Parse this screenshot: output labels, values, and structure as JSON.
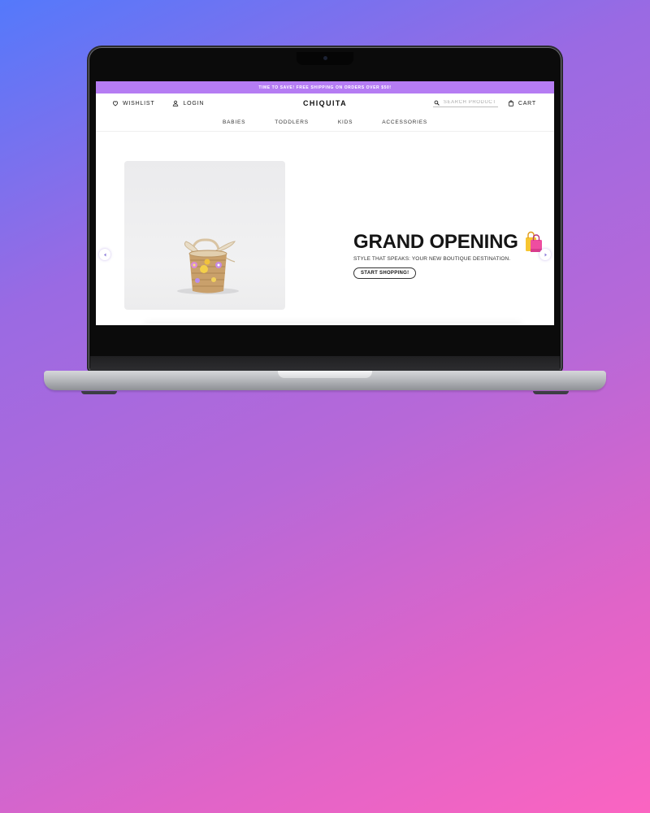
{
  "promo": {
    "text": "TIME TO SAVE! FREE SHIPPING ON ORDERS OVER $50!"
  },
  "header": {
    "wishlist_label": "WISHLIST",
    "login_label": "LOGIN",
    "brand": "CHIQUITA",
    "search_placeholder": "SEARCH PRODUCTS...",
    "cart_label": "CART"
  },
  "nav": {
    "items": [
      {
        "label": "BABIES"
      },
      {
        "label": "TODDLERS"
      },
      {
        "label": "KIDS"
      },
      {
        "label": "ACCESSORIES"
      }
    ]
  },
  "hero": {
    "title": "GRAND OPENING",
    "subtitle": "STYLE THAT SPEAKS: YOUR NEW BOUTIQUE DESTINATION.",
    "cta_label": "START SHOPPING!",
    "title_icon": "shopping-bags-icon"
  },
  "colors": {
    "promo_bar": "#b57cf3",
    "background_gradient_start": "#5479fb",
    "background_gradient_end": "#fb64c1",
    "text_primary": "#151515"
  }
}
